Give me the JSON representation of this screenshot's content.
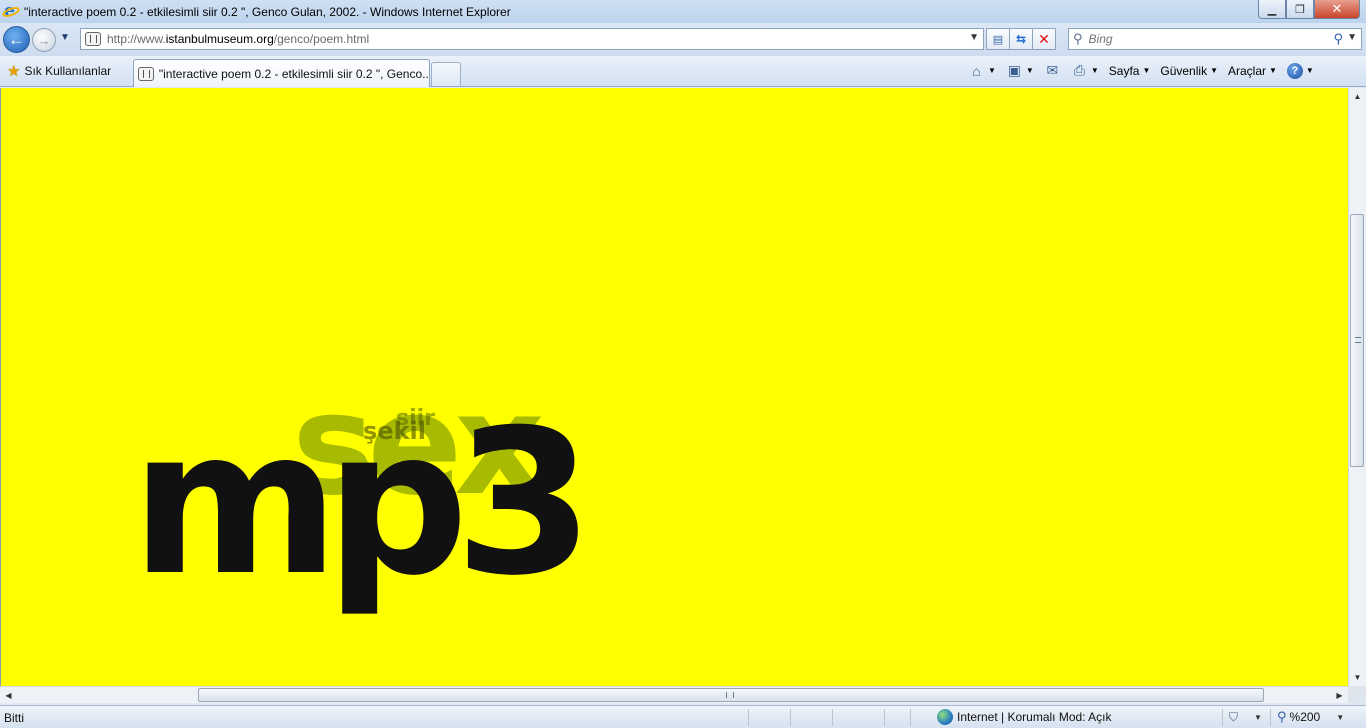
{
  "window": {
    "title": "\"interactive poem 0.2 - etkilesimli siir 0.2 \", Genco Gulan, 2002. - Windows Internet Explorer",
    "minimize_glyph": "▁",
    "maximize_glyph": "❐",
    "close_glyph": "✕"
  },
  "nav": {
    "back_glyph": "←",
    "forward_glyph": "→",
    "url_prefix": "http://www.",
    "url_host": "istanbulmuseum.org",
    "url_path": "/genco/poem.html",
    "search_placeholder": "Bing"
  },
  "favorites": {
    "label": "Sık Kullanılanlar"
  },
  "tabs": [
    {
      "label": "\"interactive poem 0.2 - etkilesimli siir 0.2 \", Genco..."
    }
  ],
  "commandbar": {
    "page": "Sayfa",
    "safety": "Güvenlik",
    "tools": "Araçlar",
    "help_glyph": "?"
  },
  "content": {
    "background": "#ffff00",
    "words": {
      "back": "sex",
      "front": "mp3",
      "small_1": "şekil",
      "small_2": "siir"
    }
  },
  "status": {
    "text": "Bitti",
    "zone": "Internet | Korumalı Mod: Açık",
    "zoom": "%200"
  }
}
